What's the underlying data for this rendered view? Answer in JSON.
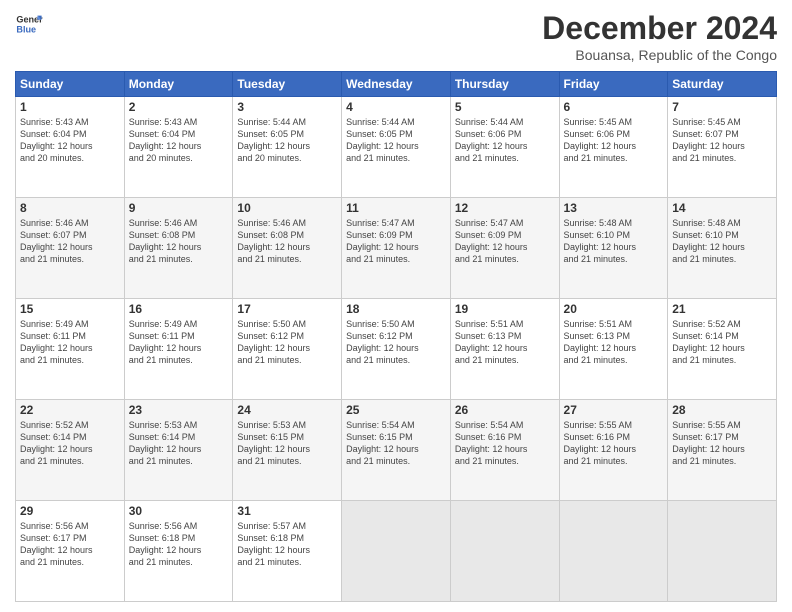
{
  "logo": {
    "line1": "General",
    "line2": "Blue"
  },
  "title": "December 2024",
  "subtitle": "Bouansa, Republic of the Congo",
  "days_of_week": [
    "Sunday",
    "Monday",
    "Tuesday",
    "Wednesday",
    "Thursday",
    "Friday",
    "Saturday"
  ],
  "weeks": [
    [
      {
        "day": "1",
        "info": "Sunrise: 5:43 AM\nSunset: 6:04 PM\nDaylight: 12 hours\nand 20 minutes."
      },
      {
        "day": "2",
        "info": "Sunrise: 5:43 AM\nSunset: 6:04 PM\nDaylight: 12 hours\nand 20 minutes."
      },
      {
        "day": "3",
        "info": "Sunrise: 5:44 AM\nSunset: 6:05 PM\nDaylight: 12 hours\nand 20 minutes."
      },
      {
        "day": "4",
        "info": "Sunrise: 5:44 AM\nSunset: 6:05 PM\nDaylight: 12 hours\nand 21 minutes."
      },
      {
        "day": "5",
        "info": "Sunrise: 5:44 AM\nSunset: 6:06 PM\nDaylight: 12 hours\nand 21 minutes."
      },
      {
        "day": "6",
        "info": "Sunrise: 5:45 AM\nSunset: 6:06 PM\nDaylight: 12 hours\nand 21 minutes."
      },
      {
        "day": "7",
        "info": "Sunrise: 5:45 AM\nSunset: 6:07 PM\nDaylight: 12 hours\nand 21 minutes."
      }
    ],
    [
      {
        "day": "8",
        "info": "Sunrise: 5:46 AM\nSunset: 6:07 PM\nDaylight: 12 hours\nand 21 minutes."
      },
      {
        "day": "9",
        "info": "Sunrise: 5:46 AM\nSunset: 6:08 PM\nDaylight: 12 hours\nand 21 minutes."
      },
      {
        "day": "10",
        "info": "Sunrise: 5:46 AM\nSunset: 6:08 PM\nDaylight: 12 hours\nand 21 minutes."
      },
      {
        "day": "11",
        "info": "Sunrise: 5:47 AM\nSunset: 6:09 PM\nDaylight: 12 hours\nand 21 minutes."
      },
      {
        "day": "12",
        "info": "Sunrise: 5:47 AM\nSunset: 6:09 PM\nDaylight: 12 hours\nand 21 minutes."
      },
      {
        "day": "13",
        "info": "Sunrise: 5:48 AM\nSunset: 6:10 PM\nDaylight: 12 hours\nand 21 minutes."
      },
      {
        "day": "14",
        "info": "Sunrise: 5:48 AM\nSunset: 6:10 PM\nDaylight: 12 hours\nand 21 minutes."
      }
    ],
    [
      {
        "day": "15",
        "info": "Sunrise: 5:49 AM\nSunset: 6:11 PM\nDaylight: 12 hours\nand 21 minutes."
      },
      {
        "day": "16",
        "info": "Sunrise: 5:49 AM\nSunset: 6:11 PM\nDaylight: 12 hours\nand 21 minutes."
      },
      {
        "day": "17",
        "info": "Sunrise: 5:50 AM\nSunset: 6:12 PM\nDaylight: 12 hours\nand 21 minutes."
      },
      {
        "day": "18",
        "info": "Sunrise: 5:50 AM\nSunset: 6:12 PM\nDaylight: 12 hours\nand 21 minutes."
      },
      {
        "day": "19",
        "info": "Sunrise: 5:51 AM\nSunset: 6:13 PM\nDaylight: 12 hours\nand 21 minutes."
      },
      {
        "day": "20",
        "info": "Sunrise: 5:51 AM\nSunset: 6:13 PM\nDaylight: 12 hours\nand 21 minutes."
      },
      {
        "day": "21",
        "info": "Sunrise: 5:52 AM\nSunset: 6:14 PM\nDaylight: 12 hours\nand 21 minutes."
      }
    ],
    [
      {
        "day": "22",
        "info": "Sunrise: 5:52 AM\nSunset: 6:14 PM\nDaylight: 12 hours\nand 21 minutes."
      },
      {
        "day": "23",
        "info": "Sunrise: 5:53 AM\nSunset: 6:14 PM\nDaylight: 12 hours\nand 21 minutes."
      },
      {
        "day": "24",
        "info": "Sunrise: 5:53 AM\nSunset: 6:15 PM\nDaylight: 12 hours\nand 21 minutes."
      },
      {
        "day": "25",
        "info": "Sunrise: 5:54 AM\nSunset: 6:15 PM\nDaylight: 12 hours\nand 21 minutes."
      },
      {
        "day": "26",
        "info": "Sunrise: 5:54 AM\nSunset: 6:16 PM\nDaylight: 12 hours\nand 21 minutes."
      },
      {
        "day": "27",
        "info": "Sunrise: 5:55 AM\nSunset: 6:16 PM\nDaylight: 12 hours\nand 21 minutes."
      },
      {
        "day": "28",
        "info": "Sunrise: 5:55 AM\nSunset: 6:17 PM\nDaylight: 12 hours\nand 21 minutes."
      }
    ],
    [
      {
        "day": "29",
        "info": "Sunrise: 5:56 AM\nSunset: 6:17 PM\nDaylight: 12 hours\nand 21 minutes."
      },
      {
        "day": "30",
        "info": "Sunrise: 5:56 AM\nSunset: 6:18 PM\nDaylight: 12 hours\nand 21 minutes."
      },
      {
        "day": "31",
        "info": "Sunrise: 5:57 AM\nSunset: 6:18 PM\nDaylight: 12 hours\nand 21 minutes."
      },
      {
        "day": "",
        "info": ""
      },
      {
        "day": "",
        "info": ""
      },
      {
        "day": "",
        "info": ""
      },
      {
        "day": "",
        "info": ""
      }
    ]
  ]
}
